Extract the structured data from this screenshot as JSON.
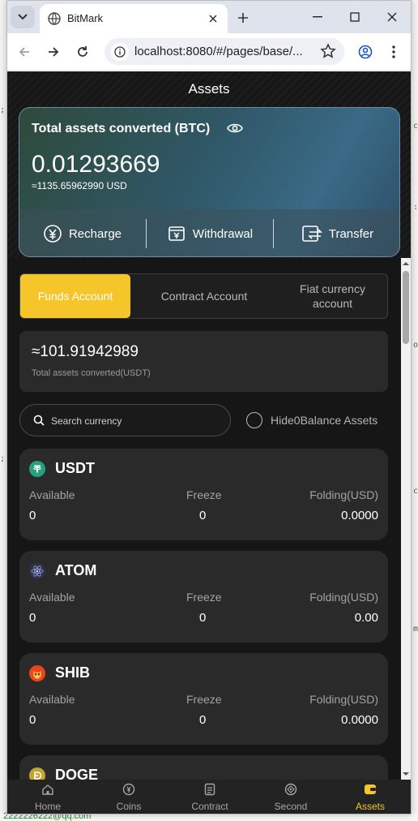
{
  "browser": {
    "tab_title": "BitMark",
    "url": "localhost:8080/#/pages/base/..."
  },
  "app": {
    "page_title": "Assets",
    "hero": {
      "title": "Total assets converted (BTC)",
      "btc_value": "0.01293669",
      "usd_value": "≈1135.65962990 USD",
      "actions": [
        "Recharge",
        "Withdrawal",
        "Transfer"
      ]
    },
    "account_tabs": [
      "Funds Account",
      "Contract Account",
      "Fiat currency account"
    ],
    "active_account_tab": "Funds Account",
    "total": {
      "amount": "≈101.91942989",
      "label": "Total assets converted(USDT)"
    },
    "search": {
      "placeholder": "Search currency"
    },
    "hide_zero_label": "Hide0Balance Assets",
    "column_labels": {
      "available": "Available",
      "freeze": "Freeze",
      "folding": "Folding(USD)"
    },
    "coins": [
      {
        "name": "USDT",
        "available": "0",
        "freeze": "0",
        "folding": "0.0000",
        "icon": "tether-icon",
        "color": "#26a17b"
      },
      {
        "name": "ATOM",
        "available": "0",
        "freeze": "0",
        "folding": "0.00",
        "icon": "atom-icon",
        "color": "#2e3148"
      },
      {
        "name": "SHIB",
        "available": "0",
        "freeze": "0",
        "folding": "0.0000",
        "icon": "shiba-icon",
        "color": "#e8471d"
      },
      {
        "name": "DOGE",
        "icon": "doge-icon",
        "color": "#c2a633"
      }
    ],
    "tabbar": [
      {
        "label": "Home",
        "icon": "home-icon"
      },
      {
        "label": "Coins",
        "icon": "coin-icon"
      },
      {
        "label": "Contract",
        "icon": "contract-icon"
      },
      {
        "label": "Second",
        "icon": "target-icon"
      },
      {
        "label": "Assets",
        "icon": "wallet-icon",
        "active": true
      }
    ],
    "accent_color": "#f6c52a"
  },
  "background": {
    "email_fragment": "2222226222@qq.com"
  }
}
